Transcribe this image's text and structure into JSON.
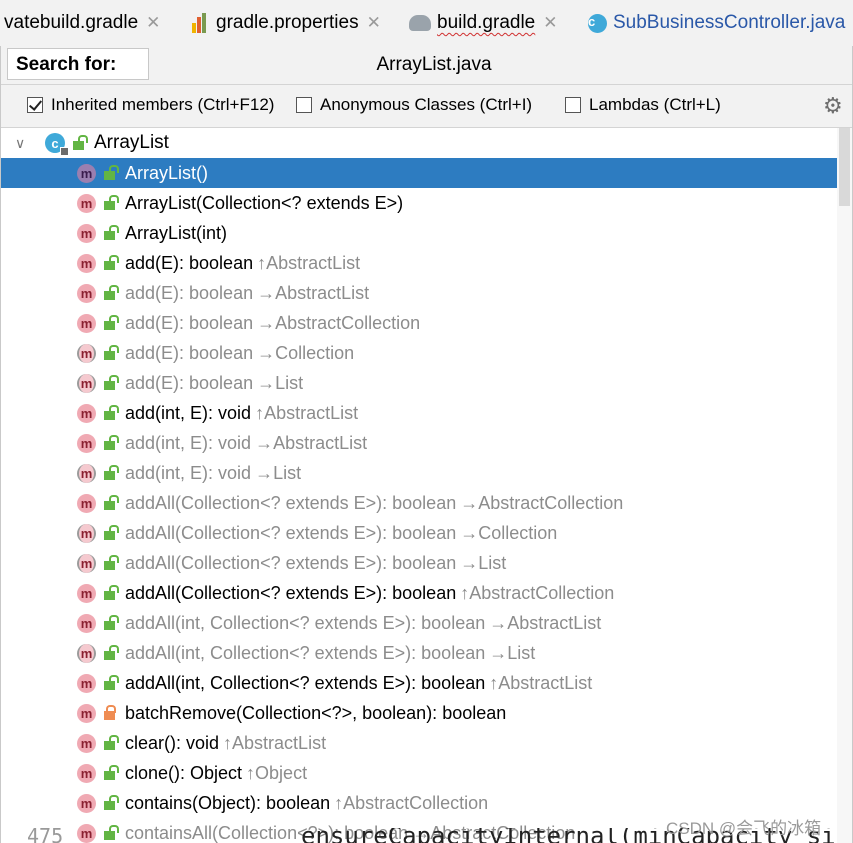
{
  "tabs": [
    {
      "label": "vatebuild.gradle",
      "icon": "gradle-file-icon"
    },
    {
      "label": "gradle.properties",
      "icon": "properties-file-icon"
    },
    {
      "label": "build.gradle",
      "icon": "gradle-elephant-icon"
    },
    {
      "label": "SubBusinessController.java",
      "icon": "java-class-icon"
    }
  ],
  "search": {
    "label": "Search for:",
    "file": "ArrayList.java"
  },
  "options": [
    {
      "label": "Inherited members (Ctrl+F12)",
      "checked": true
    },
    {
      "label": "Anonymous Classes (Ctrl+I)",
      "checked": false
    },
    {
      "label": "Lambdas (Ctrl+L)",
      "checked": false
    }
  ],
  "tree": {
    "root": "ArrayList",
    "rows": [
      {
        "name": "ArrayList()",
        "inherited": "",
        "grey": false,
        "selected": true
      },
      {
        "name": "ArrayList(Collection<? extends E>)",
        "inherited": "",
        "grey": false
      },
      {
        "name": "ArrayList(int)",
        "inherited": "",
        "grey": false
      },
      {
        "name": "add(E): boolean",
        "inherited": "↑AbstractList",
        "grey": false
      },
      {
        "name": "add(E): boolean",
        "inherited": "→AbstractList",
        "grey": true
      },
      {
        "name": "add(E): boolean",
        "inherited": "→AbstractCollection",
        "grey": true
      },
      {
        "name": "add(E): boolean",
        "inherited": "→Collection",
        "grey": true,
        "abstract": true
      },
      {
        "name": "add(E): boolean",
        "inherited": "→List",
        "grey": true,
        "abstract": true
      },
      {
        "name": "add(int, E): void",
        "inherited": "↑AbstractList",
        "grey": false
      },
      {
        "name": "add(int, E): void",
        "inherited": "→AbstractList",
        "grey": true
      },
      {
        "name": "add(int, E): void",
        "inherited": "→List",
        "grey": true,
        "abstract": true
      },
      {
        "name": "addAll(Collection<? extends E>): boolean",
        "inherited": "→AbstractCollection",
        "grey": true
      },
      {
        "name": "addAll(Collection<? extends E>): boolean",
        "inherited": "→Collection",
        "grey": true,
        "abstract": true
      },
      {
        "name": "addAll(Collection<? extends E>): boolean",
        "inherited": "→List",
        "grey": true,
        "abstract": true
      },
      {
        "name": "addAll(Collection<? extends E>): boolean",
        "inherited": "↑AbstractCollection",
        "grey": false
      },
      {
        "name": "addAll(int, Collection<? extends E>): boolean",
        "inherited": "→AbstractList",
        "grey": true
      },
      {
        "name": "addAll(int, Collection<? extends E>): boolean",
        "inherited": "→List",
        "grey": true,
        "abstract": true
      },
      {
        "name": "addAll(int, Collection<? extends E>): boolean",
        "inherited": "↑AbstractList",
        "grey": false
      },
      {
        "name": "batchRemove(Collection<?>, boolean): boolean",
        "inherited": "",
        "grey": false,
        "private": true
      },
      {
        "name": "clear(): void",
        "inherited": "↑AbstractList",
        "grey": false
      },
      {
        "name": "clone(): Object",
        "inherited": "↑Object",
        "grey": false
      },
      {
        "name": "contains(Object): boolean",
        "inherited": "↑AbstractCollection",
        "grey": false
      },
      {
        "name": "containsAll(Collection<?>): boolean",
        "inherited": "→AbstractCollection",
        "grey": true
      }
    ]
  },
  "background_code": {
    "line_number": "475",
    "text": "ensureCapacityInternal(minCapacity si"
  },
  "watermark": "CSDN @会飞的冰箱",
  "colors": {
    "selection": "#2d7cc1",
    "method_badge": "#f0a9b3",
    "public_lock": "#62b543",
    "private_lock": "#ef8c52",
    "class_badge": "#3fa9d9"
  }
}
